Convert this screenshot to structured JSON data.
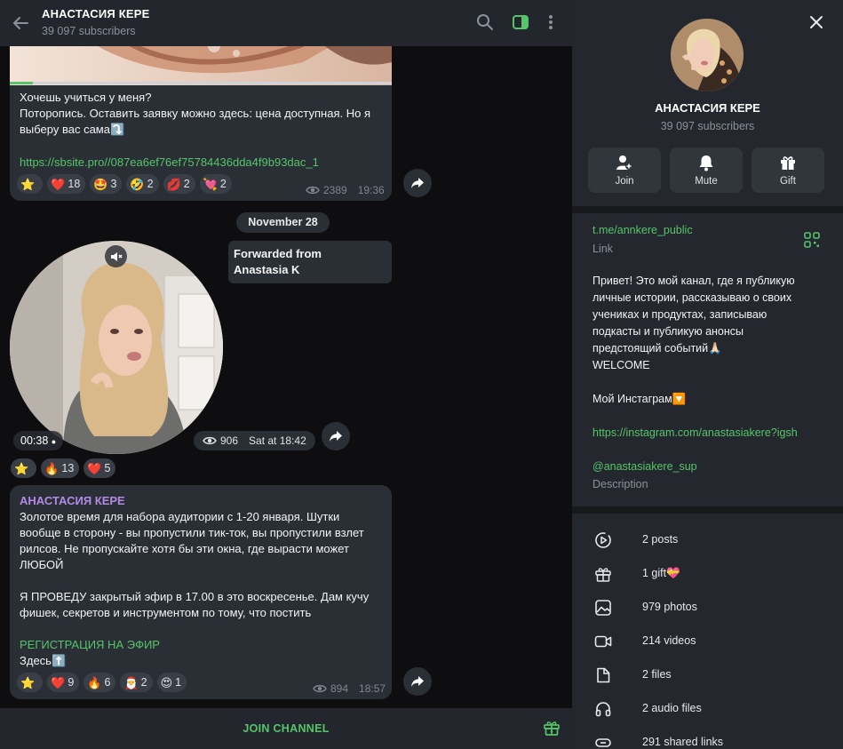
{
  "header": {
    "channel_name": "АНАСТАСИЯ КЕРЕ",
    "subscribers": "39 097 subscribers"
  },
  "messages": {
    "m1": {
      "text_line1": "Хочешь учиться у меня?",
      "text_line2": "Поторопись. Оставить заявку можно здесь: цена доступная. Но я",
      "text_line3": "выберу вас сама⤵️",
      "link": "https://sbsite.pro//087ea6ef76ef75784436dda4f9b93dac_1",
      "reactions": [
        {
          "emoji": "⭐",
          "count": ""
        },
        {
          "emoji": "❤️",
          "count": "18"
        },
        {
          "emoji": "🤩",
          "count": "3"
        },
        {
          "emoji": "🤣",
          "count": "2"
        },
        {
          "emoji": "💋",
          "count": "2"
        },
        {
          "emoji": "💘",
          "count": "2"
        }
      ],
      "views": "2389",
      "time": "19:36"
    },
    "date_separator": "November 28",
    "m2": {
      "forwarded_label": "Forwarded from",
      "forwarded_name": "Anastasia K",
      "duration": "00:38",
      "views": "906",
      "time": "Sat at 18:42",
      "reactions": [
        {
          "emoji": "⭐",
          "count": ""
        },
        {
          "emoji": "🔥",
          "count": "13"
        },
        {
          "emoji": "❤️",
          "count": "5"
        }
      ]
    },
    "m3": {
      "author": "АНАСТАСИЯ КЕРЕ",
      "p1_l1": "Золотое время для набора аудитории с 1-20 января. Шутки",
      "p1_l2": "вообще в сторону - вы пропустили тик-ток, вы пропустили взлет",
      "p1_l3": "рилсов. Не пропускайте хотя бы эти окна, где вырасти может",
      "p1_l4": "ЛЮБОЙ",
      "p2_l1": "Я ПРОВЕДУ закрытый эфир в 17.00 в это воскресенье. Дам кучу",
      "p2_l2": "фишек, секретов и инструментом по тому, что постить",
      "reg_link": "РЕГИСТРАЦИЯ НА ЭФИР",
      "here": "Здесь⬆️",
      "reactions": [
        {
          "emoji": "⭐",
          "count": ""
        },
        {
          "emoji": "❤️",
          "count": "9"
        },
        {
          "emoji": "🔥",
          "count": "6"
        },
        {
          "emoji": "🎅",
          "count": "2"
        },
        {
          "emoji": "😍",
          "count": "1"
        }
      ],
      "views": "894",
      "time": "18:57"
    }
  },
  "join_bar": {
    "label": "JOIN CHANNEL"
  },
  "panel": {
    "title": "АНАСТАСИЯ КЕРЕ",
    "subscribers": "39 097 subscribers",
    "actions": {
      "join": "Join",
      "mute": "Mute",
      "gift": "Gift"
    },
    "link": "t.me/annkere_public",
    "link_caption": "Link",
    "desc_l1": "Привет! Это мой канал, где я публикую",
    "desc_l2": "личные истории, рассказываю о своих",
    "desc_l3": "учениках и продуктах, записываю",
    "desc_l4": "подкасты и публикую анонсы",
    "desc_l5": "предстоящий событий🙏🏻",
    "desc_l6": "WELCOME",
    "desc_l7": "Мой Инстаграм🔽",
    "desc_link": "https://instagram.com/anastasiakere?igsh",
    "desc_handle": "@anastasiakere_sup",
    "desc_caption": "Description",
    "stats": {
      "posts": "2 posts",
      "gifts": "1 gift💝",
      "photos": "979 photos",
      "videos": "214 videos",
      "files": "2 files",
      "audio": "2 audio files",
      "links": "291 shared links"
    }
  },
  "colors": {
    "accent_green": "#55c46a",
    "author_purple": "#b28ae6",
    "panel_bg": "#24282e",
    "bubble_bg": "#2a2f35"
  }
}
